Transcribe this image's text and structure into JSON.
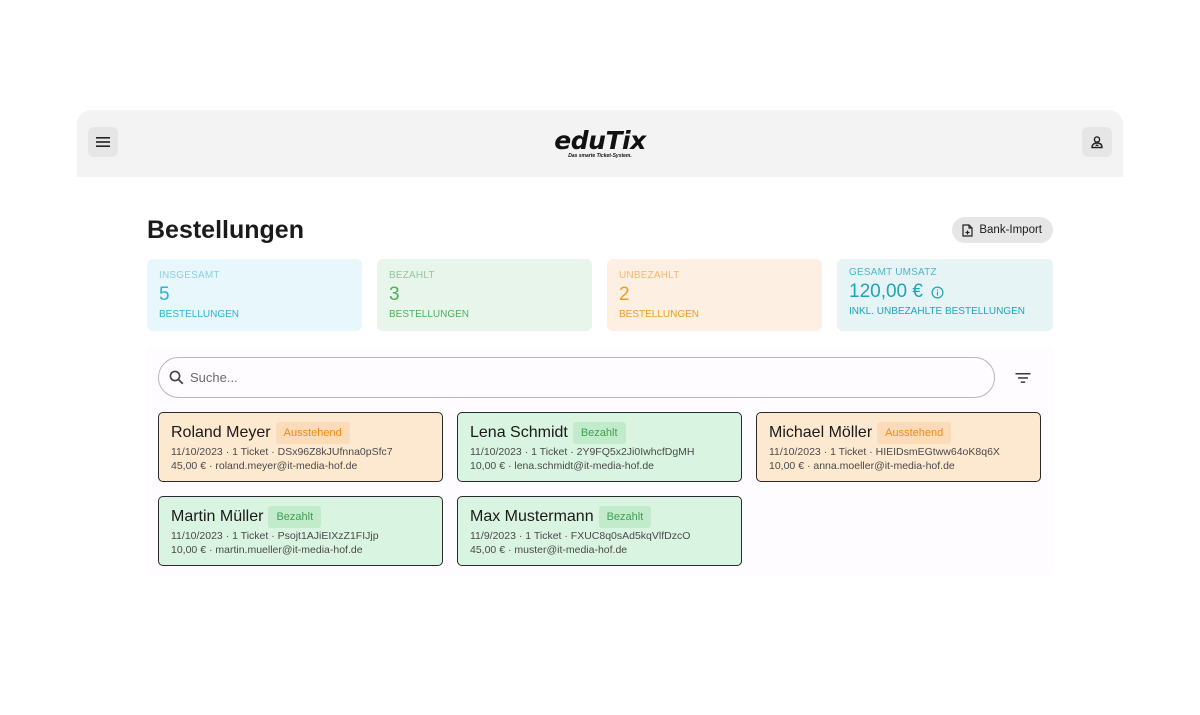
{
  "app": {
    "logo_main": "eduTix",
    "logo_sub": "Das smarte Ticket-System."
  },
  "page": {
    "title": "Bestellungen",
    "import_label": "Bank-Import"
  },
  "stats": [
    {
      "label": "Insgesamt",
      "value": "5",
      "sub": "Bestellungen"
    },
    {
      "label": "Bezahlt",
      "value": "3",
      "sub": "Bestellungen"
    },
    {
      "label": "Unbezahlt",
      "value": "2",
      "sub": "Bestellungen"
    },
    {
      "label": "Gesamt Umsatz",
      "value": "120,00 €",
      "sub": "Inkl. unbezahlte Bestellungen"
    }
  ],
  "search": {
    "placeholder": "Suche..."
  },
  "orders": [
    {
      "name": "Roland Meyer",
      "status": "Ausstehend",
      "line1": "11/10/2023 · 1 Ticket · DSx96Z8kJUfnna0pSfc7",
      "line2": "45,00 € · roland.meyer@it-media-hof.de"
    },
    {
      "name": "Lena Schmidt",
      "status": "Bezahlt",
      "line1": "11/10/2023 · 1 Ticket · 2Y9FQ5x2Ji0IwhcfDgMH",
      "line2": "10,00 € · lena.schmidt@it-media-hof.de"
    },
    {
      "name": "Michael Möller",
      "status": "Ausstehend",
      "line1": "11/10/2023 · 1 Ticket · HIEIDsmEGtww64oK8q6X",
      "line2": "10,00 € · anna.moeller@it-media-hof.de"
    },
    {
      "name": "Martin Müller",
      "status": "Bezahlt",
      "line1": "11/10/2023 · 1 Ticket · Psojt1AJiEIXzZ1FIJjp",
      "line2": "10,00 € · martin.mueller@it-media-hof.de"
    },
    {
      "name": "Max Mustermann",
      "status": "Bezahlt",
      "line1": "11/9/2023 · 1 Ticket · FXUC8q0sAd5kqVlfDzcO",
      "line2": "45,00 € · muster@it-media-hof.de"
    }
  ],
  "icons": {
    "menu": "menu-icon",
    "user": "user-badge-icon",
    "import": "file-import-icon",
    "info": "info-icon",
    "search": "search-icon",
    "filter": "filter-icon"
  },
  "colors": {
    "pending_card": "#fde8d0",
    "paid_card": "#d9f4e0",
    "accent_total": "#29b6d4",
    "accent_paid": "#4eaf5c",
    "accent_unpaid": "#f39b25",
    "accent_revenue": "#1fa4b8"
  }
}
